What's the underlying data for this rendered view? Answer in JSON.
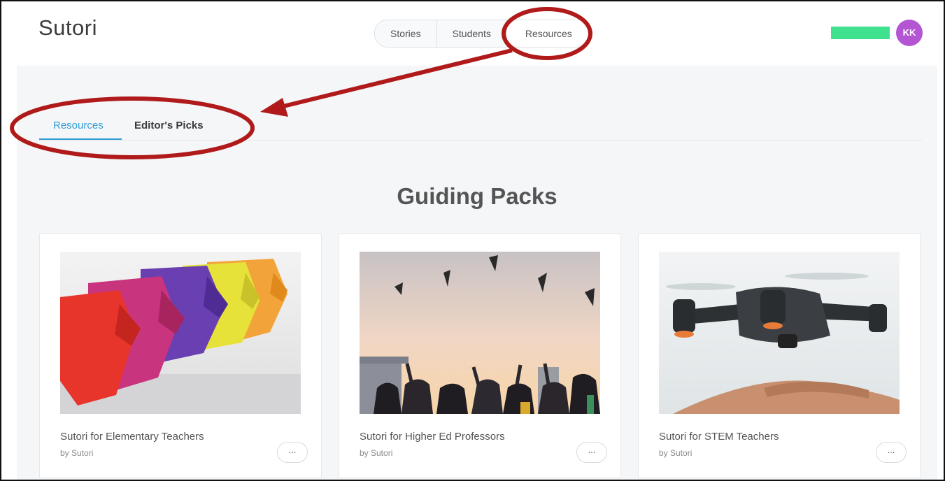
{
  "app": {
    "logo": "Sutori"
  },
  "header": {
    "nav": [
      "Stories",
      "Students",
      "Resources"
    ],
    "avatar_initials": "KK",
    "progress_color": "#3fe08e",
    "avatar_color": "#b455d3"
  },
  "tabs": [
    "Resources",
    "Editor's Picks"
  ],
  "section": {
    "title": "Guiding Packs"
  },
  "cards": [
    {
      "title": "Sutori for Elementary Teachers",
      "author": "by Sutori",
      "more": "...",
      "image": "origami-elephants"
    },
    {
      "title": "Sutori for Higher Ed Professors",
      "author": "by Sutori",
      "more": "...",
      "image": "graduation-caps"
    },
    {
      "title": "Sutori for STEM Teachers",
      "author": "by Sutori",
      "more": "...",
      "image": "drone-over-hand"
    }
  ],
  "colors": {
    "accent": "#2f9fd6",
    "annotation": "#b01a1a"
  }
}
